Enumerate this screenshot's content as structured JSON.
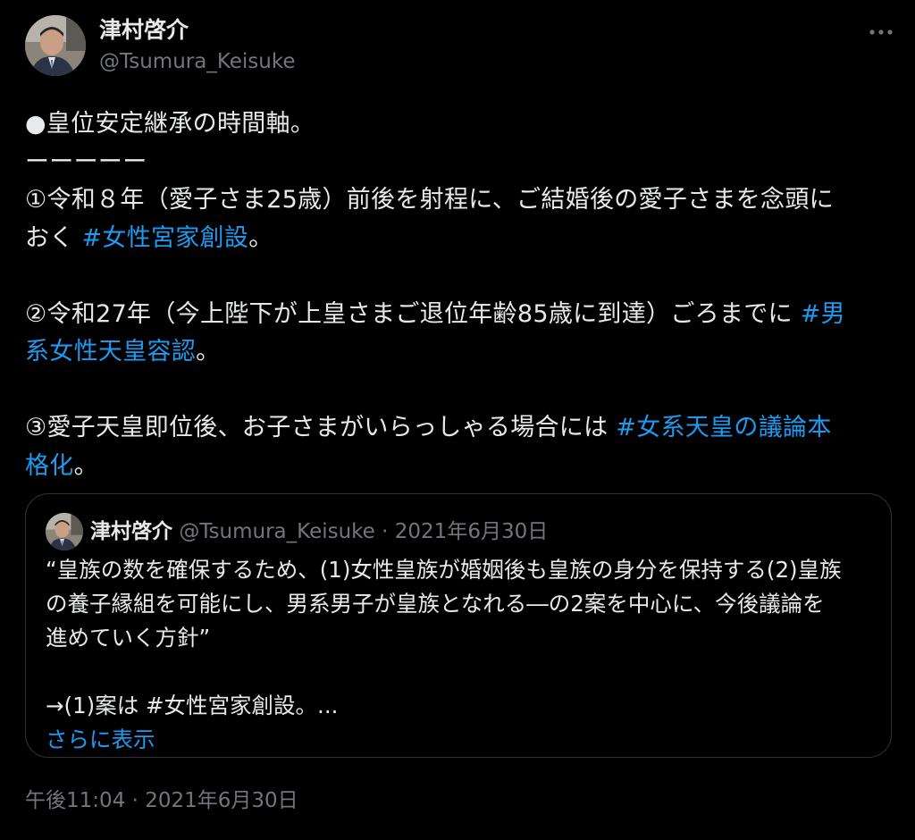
{
  "author": {
    "name": "津村啓介",
    "handle": "@Tsumura_Keisuke",
    "avatar_icon": "profile-photo-icon"
  },
  "more_icon": "ellipsis-icon",
  "tweet": {
    "lines": [
      {
        "text": "●皇位安定継承の時間軸。",
        "hashtag": ""
      },
      {
        "text": "ーーーーー",
        "hashtag": ""
      },
      {
        "text": "①令和８年（愛子さま25歳）前後を射程に、ご結婚後の愛子さまを念頭に",
        "hashtag": ""
      },
      {
        "text": "おく ",
        "hashtag": "#女性宮家創設",
        "after": "。"
      },
      {
        "text": "",
        "hashtag": ""
      },
      {
        "text": "②令和27年（今上陛下が上皇さまご退位年齢85歳に到達）ごろまでに ",
        "hashtag": "#男",
        "after": ""
      },
      {
        "text": "",
        "hashtag": "系女性天皇容認",
        "after": "。"
      },
      {
        "text": "",
        "hashtag": ""
      },
      {
        "text": "③愛子天皇即位後、お子さまがいらっしゃる場合には ",
        "hashtag": "#女系天皇の議論本",
        "after": ""
      },
      {
        "text": "",
        "hashtag": "格化",
        "after": "。"
      }
    ]
  },
  "quote": {
    "name": "津村啓介",
    "handle": "@Tsumura_Keisuke",
    "separator": " · ",
    "date": "2021年6月30日",
    "lines": [
      "“皇族の数を確保するため、(1)女性皇族が婚姻後も皇族の身分を保持する(2)皇族",
      "の養子縁組を可能にし、男系男子が皇族となれる―の2案を中心に、今後議論を",
      "進めていく方針”",
      "",
      "→(1)案は #女性宮家創設。..."
    ],
    "show_more": "さらに表示"
  },
  "timestamp": "午後11:04 · 2021年6月30日",
  "colors": {
    "background": "#000000",
    "text": "#e7e9ea",
    "secondary": "#71767b",
    "link": "#1d9bf0",
    "border": "#2f3336"
  }
}
